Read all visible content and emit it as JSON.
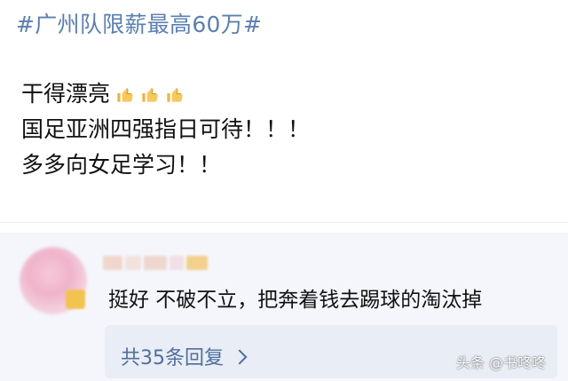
{
  "post": {
    "topic": "#广州队限薪最高60万#",
    "lines": [
      "干得漂亮",
      "国足亚洲四强指日可待！！！",
      "多多向女足学习！！"
    ]
  },
  "comment": {
    "text": "挺好 不破不立，把奔着钱去踢球的淘汰掉",
    "replies_label": "共35条回复"
  },
  "watermark": "头条 @书咚咚",
  "colors": {
    "topic": "#5a7fb4",
    "reply_link": "#4f6f9f",
    "panel_bg": "#f4f6fb",
    "reply_box_bg": "#e9edf5"
  },
  "icons": {
    "thumbs_up": "thumbs-up-icon",
    "chevron": "chevron-right-icon"
  }
}
